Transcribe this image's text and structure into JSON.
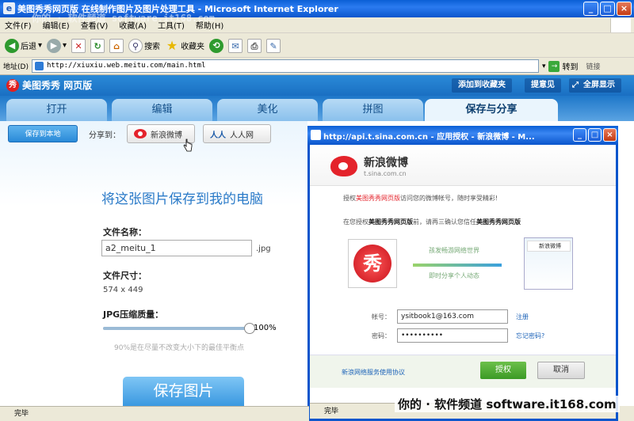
{
  "window": {
    "title": "美图秀秀网页版 在线制作图片及图片处理工具 - Microsoft Internet Explorer",
    "watermark_top": "你的 · 软件频道 software.it168.com"
  },
  "menu": [
    "文件(F)",
    "编辑(E)",
    "查看(V)",
    "收藏(A)",
    "工具(T)",
    "帮助(H)"
  ],
  "toolbar": {
    "back": "后退",
    "search": "搜索",
    "favorites": "收藏夹"
  },
  "address": {
    "label": "地址(D)",
    "url": "http://xiuxiu.web.meitu.com/main.html",
    "go": "转到",
    "links": "链接"
  },
  "app": {
    "logo": "美图秀秀 网页版",
    "header_buttons": [
      "添加到收藏夹",
      "提意见",
      "全屏显示"
    ],
    "tabs": [
      "打开",
      "编辑",
      "美化",
      "拼图",
      "保存与分享"
    ],
    "active_tab": 4,
    "save_local": "保存到本地",
    "share_to": "分享到：",
    "share_weibo": "新浪微博",
    "share_renren": "人人网",
    "heading": "将这张图片保存到我的电脑",
    "filename_label": "文件名称：",
    "filename_value": "a2_meitu_1",
    "ext": ".jpg",
    "size_label": "文件尺寸：",
    "size_value": "574 x 449",
    "quality_label": "JPG压缩质量：",
    "quality_pct": "100%",
    "quality_value": 1.0,
    "quality_hint": "90%是在尽量不改变大小下的最佳平衡点",
    "save_button": "保存图片"
  },
  "popup": {
    "title": "http://api.t.sina.com.cn - 应用授权 - 新浪微博 - M...",
    "brand": "新浪微博",
    "brand_url": "t.sina.com.cn",
    "line1_pre": "授权",
    "line1_app": "美图秀秀网页版",
    "line1_post": "访问您的微博帐号，随时享受精彩!",
    "line2_pre": "在您授权",
    "line2_app": "美图秀秀网页版",
    "line2_mid": "前，请再三确认您信任",
    "line2_app2": "美图秀秀网页版",
    "app_badge": "秀",
    "arrow_top": "孩发畅游网络世界",
    "arrow_bottom": "即时分享个人动态",
    "card_title": "新浪微博",
    "account_label": "帐号：",
    "account_value": "ysitbook1@163.com",
    "register": "注册",
    "password_label": "密码：",
    "password_value": "••••••••••",
    "forgot": "忘记密码?",
    "agreement": "新浪网络服务使用协议",
    "authorize": "授权",
    "cancel": "取消",
    "status": "完毕"
  },
  "status": {
    "text": "完毕"
  },
  "watermark": "你的 · 软件频道 software.it168.com"
}
